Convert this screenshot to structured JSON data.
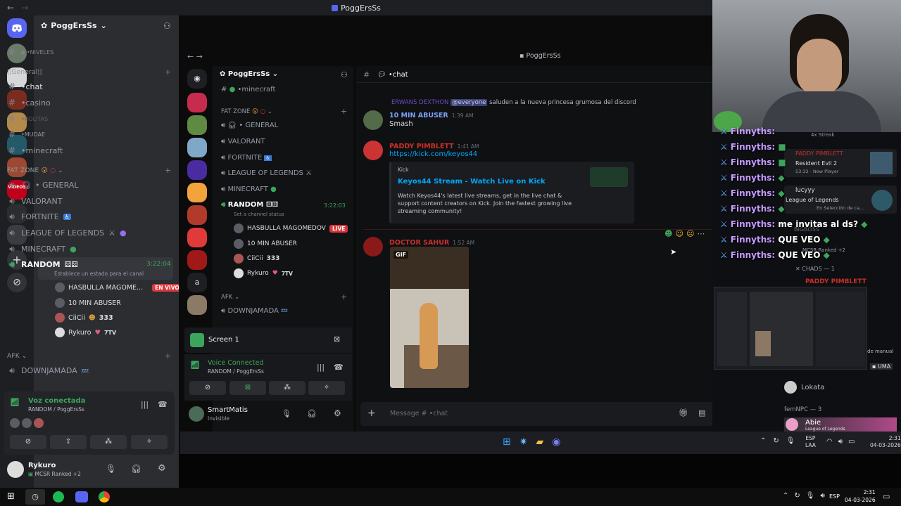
{
  "outer": {
    "title": "PoggErsSs",
    "nav_back": "←",
    "nav_forward": "→",
    "server_name": "PoggErsSs",
    "channels": [
      {
        "icon": "#",
        "label": "▪ •NIVELES"
      },
      {
        "icon": "#",
        "label": "•chat"
      },
      {
        "icon": "#",
        "label": "•casino"
      },
      {
        "icon": "#",
        "label": "•ROLITAS"
      },
      {
        "icon": "#",
        "label": "•MUDAE"
      },
      {
        "icon": "#",
        "label": "•minecraft"
      }
    ],
    "category_general": "|¦General¦|",
    "category_fatzone": "FAT ZONE",
    "voice_channels": [
      {
        "label": "• GENERAL"
      },
      {
        "label": "VALORANT"
      },
      {
        "label": "FORTNITE"
      },
      {
        "label": "LEAGUE OF LEGENDS"
      },
      {
        "label": "MINECRAFT"
      }
    ],
    "random": {
      "label": "RANDOM",
      "timer": "3:22:04",
      "status": "Establece un estado para el canal"
    },
    "voice_users": [
      {
        "name": "HASBULLA MAGOME...",
        "badge": "EN VIVO"
      },
      {
        "name": "10 MIN ABUSER",
        "badge": ""
      },
      {
        "name": "CiiCii",
        "badge": "333"
      },
      {
        "name": "Rykuro",
        "badge": "7TV"
      }
    ],
    "category_afk": "AFK",
    "afk_channel": "DOWNJAMADA",
    "voice_panel": {
      "status": "Voz conectada",
      "channel": "RANDOM / PoggErsSs"
    },
    "user": {
      "name": "Rykuro",
      "status": "MCSR Ranked +2"
    }
  },
  "inner": {
    "title": "PoggErsSs",
    "server_name": "PoggErsSs",
    "top_channel": "•minecraft",
    "category_fatzone": "FAT ZONE",
    "voice_channels": [
      {
        "label": "• GENERAL"
      },
      {
        "label": "VALORANT"
      },
      {
        "label": "FORTNITE"
      },
      {
        "label": "LEAGUE OF LEGENDS"
      },
      {
        "label": "MINECRAFT"
      }
    ],
    "random": {
      "label": "RANDOM",
      "timer": "3:22:03",
      "status": "Set a channel status"
    },
    "voice_users": [
      {
        "name": "HASBULLA MAGOMEDOV",
        "badge": "LIVE"
      },
      {
        "name": "10 MIN ABUSER",
        "badge": ""
      },
      {
        "name": "CiiCii",
        "badge": "333"
      },
      {
        "name": "Rykuro",
        "badge": "7TV"
      }
    ],
    "category_afk": "AFK",
    "afk_channel": "DOWNJAMADA",
    "screen_share": "Screen 1",
    "voice_panel": {
      "status": "Voice Connected",
      "channel": "RANDOM / PoggErsSs"
    },
    "user": {
      "name": "SmartMatis",
      "status": "Invisible"
    },
    "chat": {
      "channel": "•chat",
      "reply_author": "ERWANS DEXTHON",
      "reply_mention": "@everyone",
      "reply_text": "saluden a la nueva princesa grumosa del discord",
      "messages": [
        {
          "author": "10 MIN ABUSER",
          "time": "1:39 AM",
          "text": "Smash",
          "color": "#7aa2f7"
        },
        {
          "author": "PADDY PIMBLETT",
          "time": "1:41 AM",
          "text": "https://kick.com/keyos44",
          "color": "#e0413e"
        },
        {
          "author": "DOCTOR SAHUR",
          "time": "1:52 AM",
          "text": "",
          "color": "#e0413e"
        }
      ],
      "embed": {
        "provider": "Kick",
        "title": "Keyos44 Stream - Watch Live on Kick",
        "desc": "Watch Keyos44's latest live streams, get in the live chat & support content creators on Kick. Join the fastest growing live streaming community!"
      },
      "gif_label": "GIF",
      "input_placeholder": "Message # •chat"
    }
  },
  "overlay_chat": [
    {
      "name": "Finnyths:",
      "text": ""
    },
    {
      "name": "Finnyths:",
      "text": ""
    },
    {
      "name": "Finnyths:",
      "text": ""
    },
    {
      "name": "Finnyths:",
      "text": ""
    },
    {
      "name": "Finnyths:",
      "text": ""
    },
    {
      "name": "Finnyths:",
      "text": ""
    },
    {
      "name": "Finnyths:",
      "text": "me invitas al ds?"
    },
    {
      "name": "Finnyths:",
      "text": "QUE VEO"
    },
    {
      "name": "Finnyths:",
      "text": "QUE VEO"
    }
  ],
  "right_members": {
    "streak": "4x Streak",
    "act1_name": "PADDY PIMBLETT",
    "act1_game": "Resident Evil 2",
    "act1_sub": "53:32 · New Player",
    "act2_name": "lucyyy",
    "act2_game": "League of Legends",
    "act2_sub": "En Selección de ca...",
    "bigboss": "BIGBOSS",
    "bigboss_sub": "MCSR Ranked +2",
    "chads": "CHADS — 1",
    "paddy": "PADDY PIMBLETT",
    "mini_screen_note": "de manual",
    "uma": "UMA",
    "lokata": "Lokata",
    "femnpc": "femNPC — 3",
    "abie": "Abie",
    "abie_sub": "League of Legends"
  },
  "inner_taskbar": {
    "lang": "ESP",
    "lang2": "LAA",
    "time": "2:31",
    "date": "04-03-2026"
  },
  "taskbar": {
    "lang": "ESP",
    "time": "2:31",
    "date": "04-03-2026"
  }
}
